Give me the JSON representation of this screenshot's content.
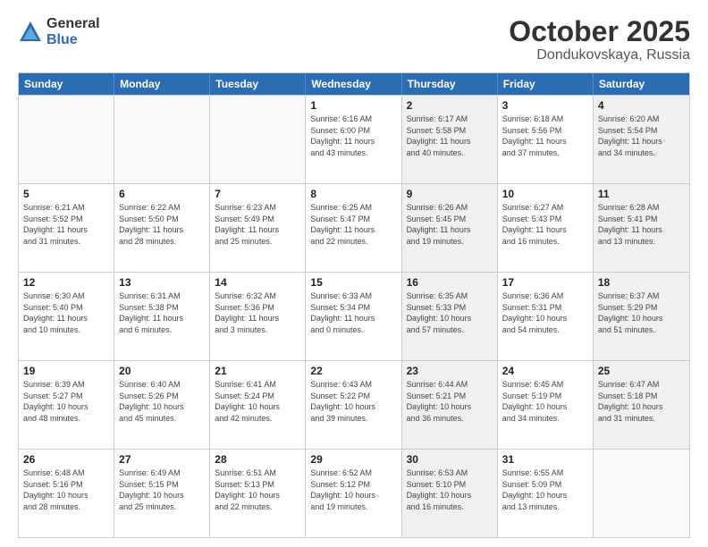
{
  "header": {
    "logo_general": "General",
    "logo_blue": "Blue",
    "title": "October 2025",
    "subtitle": "Dondukovskaya, Russia"
  },
  "days_of_week": [
    "Sunday",
    "Monday",
    "Tuesday",
    "Wednesday",
    "Thursday",
    "Friday",
    "Saturday"
  ],
  "rows": [
    [
      {
        "num": "",
        "info": "",
        "empty": true
      },
      {
        "num": "",
        "info": "",
        "empty": true
      },
      {
        "num": "",
        "info": "",
        "empty": true
      },
      {
        "num": "1",
        "info": "Sunrise: 6:16 AM\nSunset: 6:00 PM\nDaylight: 11 hours\nand 43 minutes.",
        "shaded": false
      },
      {
        "num": "2",
        "info": "Sunrise: 6:17 AM\nSunset: 5:58 PM\nDaylight: 11 hours\nand 40 minutes.",
        "shaded": true
      },
      {
        "num": "3",
        "info": "Sunrise: 6:18 AM\nSunset: 5:56 PM\nDaylight: 11 hours\nand 37 minutes.",
        "shaded": false
      },
      {
        "num": "4",
        "info": "Sunrise: 6:20 AM\nSunset: 5:54 PM\nDaylight: 11 hours\nand 34 minutes.",
        "shaded": true
      }
    ],
    [
      {
        "num": "5",
        "info": "Sunrise: 6:21 AM\nSunset: 5:52 PM\nDaylight: 11 hours\nand 31 minutes.",
        "shaded": false
      },
      {
        "num": "6",
        "info": "Sunrise: 6:22 AM\nSunset: 5:50 PM\nDaylight: 11 hours\nand 28 minutes.",
        "shaded": false
      },
      {
        "num": "7",
        "info": "Sunrise: 6:23 AM\nSunset: 5:49 PM\nDaylight: 11 hours\nand 25 minutes.",
        "shaded": false
      },
      {
        "num": "8",
        "info": "Sunrise: 6:25 AM\nSunset: 5:47 PM\nDaylight: 11 hours\nand 22 minutes.",
        "shaded": false
      },
      {
        "num": "9",
        "info": "Sunrise: 6:26 AM\nSunset: 5:45 PM\nDaylight: 11 hours\nand 19 minutes.",
        "shaded": true
      },
      {
        "num": "10",
        "info": "Sunrise: 6:27 AM\nSunset: 5:43 PM\nDaylight: 11 hours\nand 16 minutes.",
        "shaded": false
      },
      {
        "num": "11",
        "info": "Sunrise: 6:28 AM\nSunset: 5:41 PM\nDaylight: 11 hours\nand 13 minutes.",
        "shaded": true
      }
    ],
    [
      {
        "num": "12",
        "info": "Sunrise: 6:30 AM\nSunset: 5:40 PM\nDaylight: 11 hours\nand 10 minutes.",
        "shaded": false
      },
      {
        "num": "13",
        "info": "Sunrise: 6:31 AM\nSunset: 5:38 PM\nDaylight: 11 hours\nand 6 minutes.",
        "shaded": false
      },
      {
        "num": "14",
        "info": "Sunrise: 6:32 AM\nSunset: 5:36 PM\nDaylight: 11 hours\nand 3 minutes.",
        "shaded": false
      },
      {
        "num": "15",
        "info": "Sunrise: 6:33 AM\nSunset: 5:34 PM\nDaylight: 11 hours\nand 0 minutes.",
        "shaded": false
      },
      {
        "num": "16",
        "info": "Sunrise: 6:35 AM\nSunset: 5:33 PM\nDaylight: 10 hours\nand 57 minutes.",
        "shaded": true
      },
      {
        "num": "17",
        "info": "Sunrise: 6:36 AM\nSunset: 5:31 PM\nDaylight: 10 hours\nand 54 minutes.",
        "shaded": false
      },
      {
        "num": "18",
        "info": "Sunrise: 6:37 AM\nSunset: 5:29 PM\nDaylight: 10 hours\nand 51 minutes.",
        "shaded": true
      }
    ],
    [
      {
        "num": "19",
        "info": "Sunrise: 6:39 AM\nSunset: 5:27 PM\nDaylight: 10 hours\nand 48 minutes.",
        "shaded": false
      },
      {
        "num": "20",
        "info": "Sunrise: 6:40 AM\nSunset: 5:26 PM\nDaylight: 10 hours\nand 45 minutes.",
        "shaded": false
      },
      {
        "num": "21",
        "info": "Sunrise: 6:41 AM\nSunset: 5:24 PM\nDaylight: 10 hours\nand 42 minutes.",
        "shaded": false
      },
      {
        "num": "22",
        "info": "Sunrise: 6:43 AM\nSunset: 5:22 PM\nDaylight: 10 hours\nand 39 minutes.",
        "shaded": false
      },
      {
        "num": "23",
        "info": "Sunrise: 6:44 AM\nSunset: 5:21 PM\nDaylight: 10 hours\nand 36 minutes.",
        "shaded": true
      },
      {
        "num": "24",
        "info": "Sunrise: 6:45 AM\nSunset: 5:19 PM\nDaylight: 10 hours\nand 34 minutes.",
        "shaded": false
      },
      {
        "num": "25",
        "info": "Sunrise: 6:47 AM\nSunset: 5:18 PM\nDaylight: 10 hours\nand 31 minutes.",
        "shaded": true
      }
    ],
    [
      {
        "num": "26",
        "info": "Sunrise: 6:48 AM\nSunset: 5:16 PM\nDaylight: 10 hours\nand 28 minutes.",
        "shaded": false
      },
      {
        "num": "27",
        "info": "Sunrise: 6:49 AM\nSunset: 5:15 PM\nDaylight: 10 hours\nand 25 minutes.",
        "shaded": false
      },
      {
        "num": "28",
        "info": "Sunrise: 6:51 AM\nSunset: 5:13 PM\nDaylight: 10 hours\nand 22 minutes.",
        "shaded": false
      },
      {
        "num": "29",
        "info": "Sunrise: 6:52 AM\nSunset: 5:12 PM\nDaylight: 10 hours\nand 19 minutes.",
        "shaded": false
      },
      {
        "num": "30",
        "info": "Sunrise: 6:53 AM\nSunset: 5:10 PM\nDaylight: 10 hours\nand 16 minutes.",
        "shaded": true
      },
      {
        "num": "31",
        "info": "Sunrise: 6:55 AM\nSunset: 5:09 PM\nDaylight: 10 hours\nand 13 minutes.",
        "shaded": false
      },
      {
        "num": "",
        "info": "",
        "empty": true
      }
    ]
  ]
}
